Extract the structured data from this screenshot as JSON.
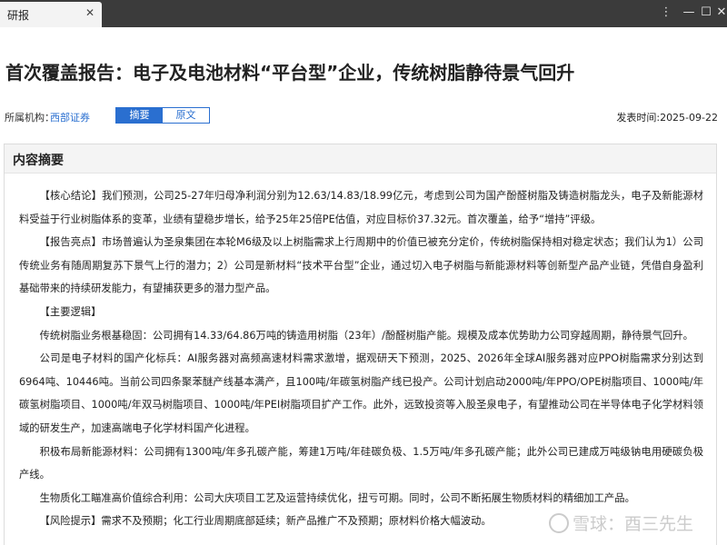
{
  "window": {
    "tab_label": "研报",
    "close_glyph": "✕",
    "more_glyph": "⋮",
    "minimize_glyph": "—",
    "maximize_glyph": "☐",
    "close_window_glyph": "✕"
  },
  "header": {
    "title": "首次覆盖报告：电子及电池材料“平台型”企业，传统树脂静待景气回升",
    "org_label": "所属机构：",
    "org_value": "西部证券",
    "toggle": {
      "summary": "摘要",
      "original": "原文"
    },
    "publish_date": "发表时间:2025-09-22"
  },
  "panel": {
    "heading": "内容摘要",
    "paragraphs": [
      "【核心结论】我们预测，公司25-27年归母净利润分别为12.63/14.83/18.99亿元，考虑到公司为国产酚醛树脂及铸造树脂龙头，电子及新能源材料受益于行业树脂体系的变革，业绩有望稳步增长，给予25年25倍PE估值，对应目标价37.32元。首次覆盖，给予“增持”评级。",
      "【报告亮点】市场普遍认为圣泉集团在本轮M6级及以上树脂需求上行周期中的价值已被充分定价，传统树脂保持相对稳定状态；我们认为1）公司传统业务有随周期复苏下景气上行的潜力；2）公司是新材料“技术平台型”企业，通过切入电子树脂与新能源材料等创新型产品产业链，凭借自身盈利基础带来的持续研发能力，有望捕获更多的潜力型产品。",
      "【主要逻辑】",
      "传统树脂业务根基稳固：公司拥有14.33/64.86万吨的铸造用树脂（23年）/酚醛树脂产能。规模及成本优势助力公司穿越周期，静待景气回升。",
      "公司是电子材料的国产化标兵：AI服务器对高频高速材料需求激增，据观研天下预测，2025、2026年全球AI服务器对应PPO树脂需求分别达到6964吨、10446吨。当前公司四条聚苯醚产线基本满产，且100吨/年碳氢树脂产线已投产。公司计划启动2000吨/年PPO/OPE树脂项目、1000吨/年碳氢树脂项目、1000吨/年双马树脂项目、1000吨/年PEI树脂项目扩产工作。此外，远致投资等入股圣泉电子，有望推动公司在半导体电子化学材料领域的研发生产，加速高端电子化学材料国产化进程。",
      "积极布局新能源材料：公司拥有1300吨/年多孔碳产能，筹建1万吨/年硅碳负极、1.5万吨/年多孔碳产能；此外公司已建成万吨级钠电用硬碳负极产线。",
      "生物质化工瞄准高价值综合利用：公司大庆项目工艺及运营持续优化，扭亏可期。同时，公司不断拓展生物质材料的精细加工产品。",
      "【风险提示】需求不及预期；化工行业周期底部延续；新产品推广不及预期；原材料价格大幅波动。"
    ]
  },
  "watermark": {
    "text": "雪球：酉三先生"
  },
  "colors": {
    "accent": "#2a6fd0",
    "titlebar": "#3b3b3b"
  }
}
